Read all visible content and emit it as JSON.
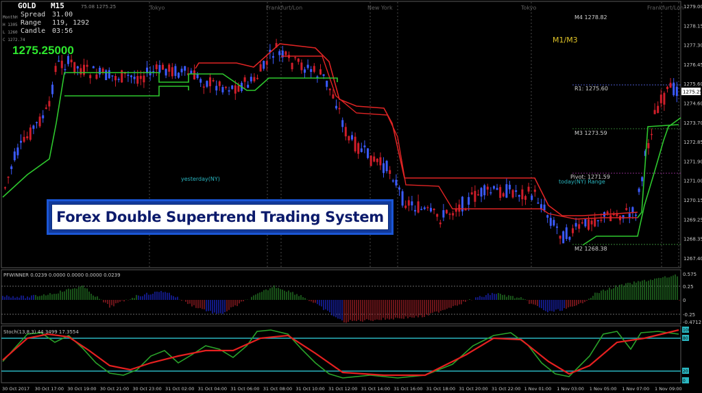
{
  "info_panel": {
    "symbol": "GOLD",
    "timeframe": "M15",
    "spread_label": "Spread",
    "spread_value": "31.00",
    "range_label": "Range",
    "range_value": "119, 1292",
    "candle_label": "Candle",
    "candle_value": "03:56",
    "line_month_high": "MonthH",
    "line_h": "H 1305",
    "line_l": "L 1260",
    "line_c": "C 1272.74",
    "current_price": "1275.25000"
  },
  "top_line_text": "75.08 1275.25",
  "sessions": [
    "Tokyo",
    "Frankfurt/Lon",
    "New York",
    "Tokyo",
    "Frankfurt/Lon"
  ],
  "indicator_label": "M1/M3",
  "title_banner": "Forex Double Supertrend Trading System",
  "level_labels": [
    {
      "name": "M4",
      "value": "1278.82"
    },
    {
      "name": "R1",
      "value": "1275.60"
    },
    {
      "name": "M3",
      "value": "1273.59"
    },
    {
      "name": "Pivot",
      "value": "1271.59"
    },
    {
      "name": "M2",
      "value": "1268.38"
    }
  ],
  "zone_labels": [
    "yesterday(NY)",
    "today(NY) Range"
  ],
  "price_axis": [
    "1279.00",
    "1278.15",
    "1277.30",
    "1276.45",
    "1275.60",
    "1274.60",
    "1273.70",
    "1272.85",
    "1271.90",
    "1271.00",
    "1270.15",
    "1269.25",
    "1268.35",
    "1267.40"
  ],
  "current_price_tag": "1275.25",
  "pfwinner": {
    "label": "PFWINNER 0.0239 0.0000 0.0000 0.0000 0.0239",
    "axis": [
      "0.575",
      "0.25",
      "0",
      "-0.25",
      "-0.4712"
    ]
  },
  "stoch": {
    "label": "Stoch(13,8,3) 44.3499 17.3554",
    "axis": [
      "100",
      "80",
      "20",
      "0"
    ]
  },
  "time_axis": [
    "30 Oct 2017",
    "30 Oct 17:00",
    "30 Oct 19:00",
    "30 Oct 21:00",
    "30 Oct 23:00",
    "31 Oct 02:00",
    "31 Oct 04:00",
    "31 Oct 06:00",
    "31 Oct 08:00",
    "31 Oct 10:00",
    "31 Oct 12:00",
    "31 Oct 14:00",
    "31 Oct 16:00",
    "31 Oct 18:00",
    "31 Oct 20:00",
    "31 Oct 22:00",
    "1 Nov 01:00",
    "1 Nov 03:00",
    "1 Nov 05:00",
    "1 Nov 07:00",
    "1 Nov 09:00"
  ],
  "colors": {
    "background": "#000000",
    "bull_candle": "#3b5bff",
    "bear_candle": "#d01e2a",
    "supertrend_up": "#2ec82e",
    "supertrend_down": "#e02424",
    "stoch_main": "#2aa32a",
    "stoch_signal": "#e62020",
    "stoch_levels": "#2ab6c0",
    "hist_blue": "#1e2ad8",
    "hist_green": "#2a8a2a",
    "hist_red": "#b0222a"
  }
}
